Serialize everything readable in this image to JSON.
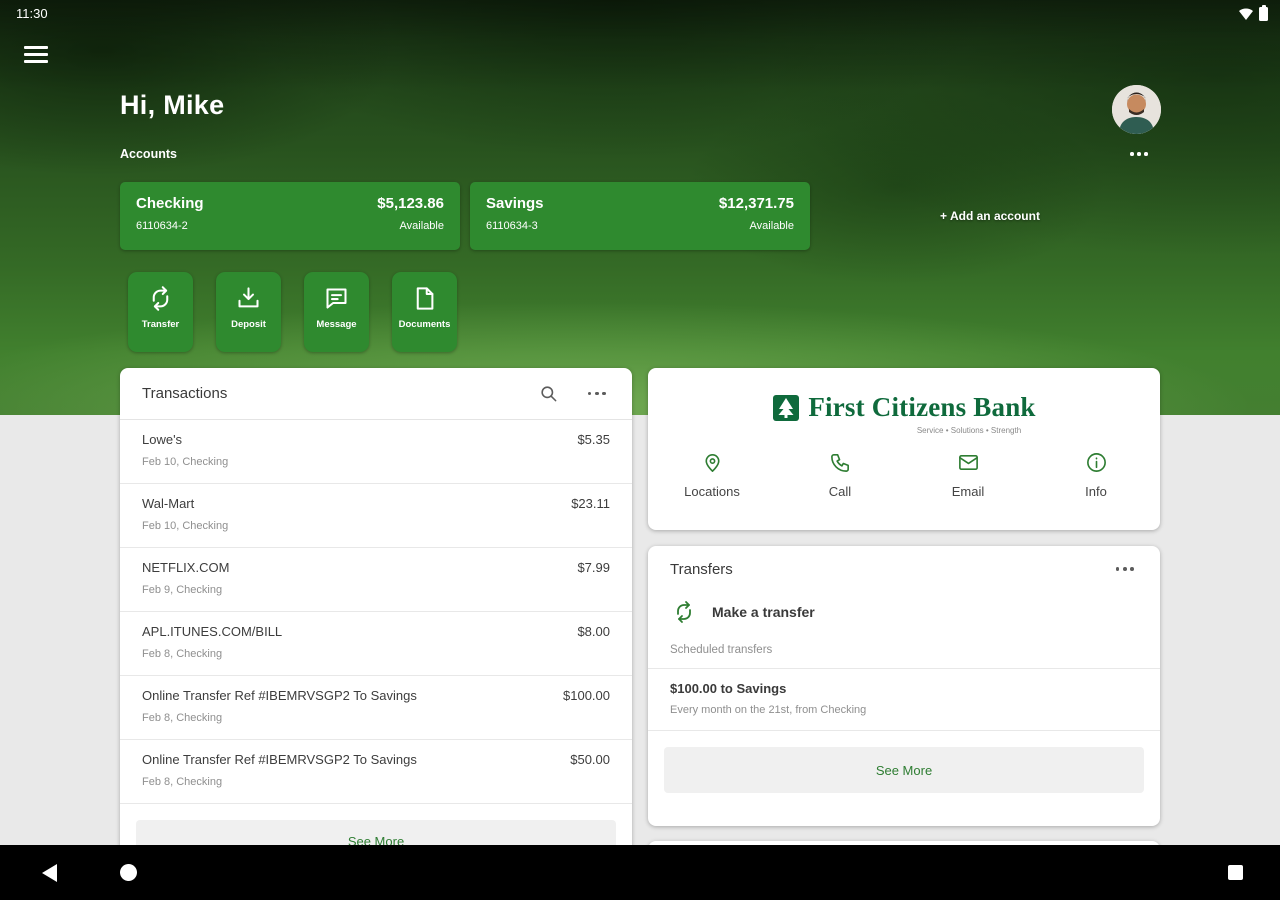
{
  "status_bar": {
    "time": "11:30"
  },
  "header": {
    "greeting": "Hi, Mike",
    "accounts_label": "Accounts",
    "add_account_label": "+ Add an account"
  },
  "accounts": [
    {
      "name": "Checking",
      "number": "6110634-2",
      "amount": "$5,123.86",
      "status": "Available"
    },
    {
      "name": "Savings",
      "number": "6110634-3",
      "amount": "$12,371.75",
      "status": "Available"
    }
  ],
  "quick_actions": [
    {
      "label": "Transfer",
      "icon": "transfer-icon"
    },
    {
      "label": "Deposit",
      "icon": "deposit-icon"
    },
    {
      "label": "Message",
      "icon": "message-icon"
    },
    {
      "label": "Documents",
      "icon": "documents-icon"
    }
  ],
  "transactions": {
    "title": "Transactions",
    "see_more": "See More",
    "items": [
      {
        "name": "Lowe's",
        "detail": "Feb 10, Checking",
        "amount": "$5.35"
      },
      {
        "name": "Wal-Mart",
        "detail": "Feb 10, Checking",
        "amount": "$23.11"
      },
      {
        "name": "NETFLIX.COM",
        "detail": "Feb 9, Checking",
        "amount": "$7.99"
      },
      {
        "name": "APL.ITUNES.COM/BILL",
        "detail": "Feb 8, Checking",
        "amount": "$8.00"
      },
      {
        "name": "Online Transfer Ref #IBEMRVSGP2 To Savings",
        "detail": "Feb 8, Checking",
        "amount": "$100.00"
      },
      {
        "name": "Online Transfer Ref #IBEMRVSGP2 To Savings",
        "detail": "Feb 8, Checking",
        "amount": "$50.00"
      }
    ]
  },
  "bank": {
    "name": "First Citizens Bank",
    "tagline": "Service • Solutions • Strength",
    "actions": [
      {
        "label": "Locations",
        "icon": "location-pin-icon"
      },
      {
        "label": "Call",
        "icon": "phone-icon"
      },
      {
        "label": "Email",
        "icon": "envelope-icon"
      },
      {
        "label": "Info",
        "icon": "info-icon"
      }
    ]
  },
  "transfers": {
    "title": "Transfers",
    "make_transfer": "Make a transfer",
    "scheduled_label": "Scheduled transfers",
    "scheduled": [
      {
        "title": "$100.00 to Savings",
        "detail": "Every month on the 21st, from Checking"
      }
    ],
    "see_more": "See More"
  },
  "colors": {
    "account_card_green": "#2f8a2f",
    "accent_green": "#2e7d32",
    "logo_green": "#0f6a3c",
    "navbar_black": "#000000"
  }
}
